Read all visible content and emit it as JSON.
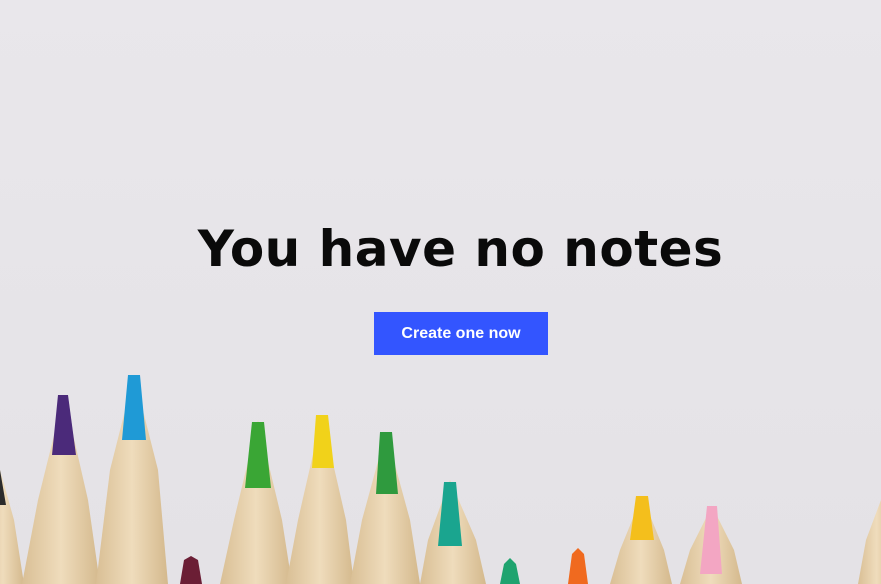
{
  "empty_state": {
    "title": "You have no notes",
    "button_label": "Create one now"
  },
  "colors": {
    "background": "#e8e6ea",
    "button": "#3355ff",
    "button_text": "#ffffff",
    "title": "#0a0a0a"
  },
  "background_image": {
    "subject": "colored-pencils",
    "pencil_tip_colors": [
      "#2b2b2b",
      "#4b2a7a",
      "#1f9ad6",
      "#6b1e35",
      "#3aa635",
      "#f1d21a",
      "#2f9a3e",
      "#1aa58f",
      "#1fa36f",
      "#f06a1f",
      "#f4bf1c",
      "#f3a6c3"
    ]
  }
}
